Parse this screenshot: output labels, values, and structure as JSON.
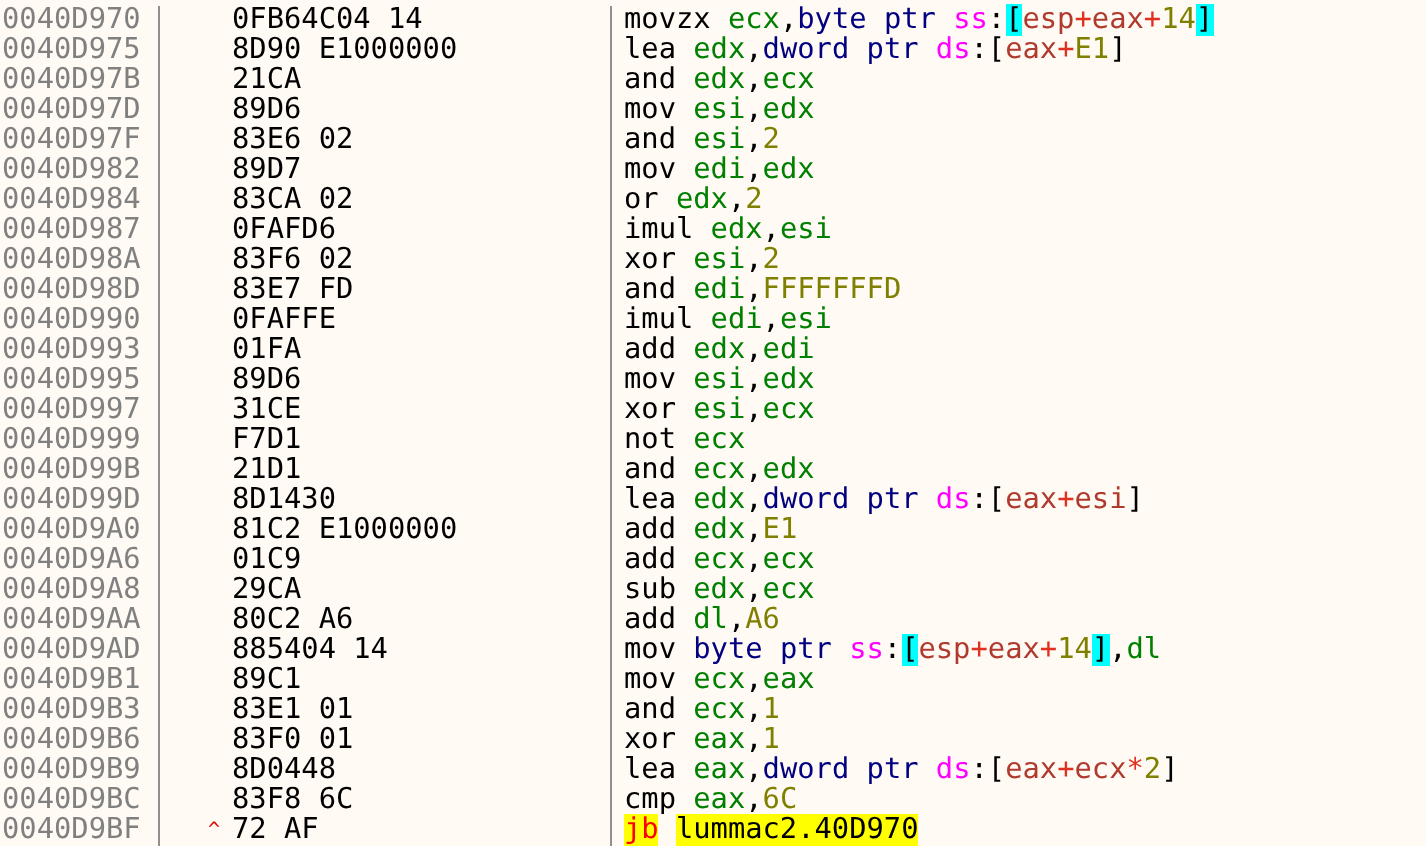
{
  "rows": [
    {
      "address": "0040D970",
      "bytes": "0FB64C04 14",
      "tokens": [
        {
          "text": "movzx",
          "kind": "mnemonic"
        },
        {
          "text": "ecx",
          "kind": "register"
        },
        {
          "text": ",",
          "kind": "punct"
        },
        {
          "text": "byte ptr",
          "kind": "size"
        },
        {
          "text": "ss",
          "kind": "segment"
        },
        {
          "text": ":",
          "kind": "punct"
        },
        {
          "text": "[",
          "kind": "stack_bracket"
        },
        {
          "text": "esp",
          "kind": "mem_register"
        },
        {
          "text": "+",
          "kind": "mem_operator"
        },
        {
          "text": "eax",
          "kind": "mem_register"
        },
        {
          "text": "+",
          "kind": "mem_operator"
        },
        {
          "text": "14",
          "kind": "mem_number"
        },
        {
          "text": "]",
          "kind": "stack_bracket"
        }
      ]
    },
    {
      "address": "0040D975",
      "bytes": "8D90 E1000000",
      "tokens": [
        {
          "text": "lea",
          "kind": "mnemonic"
        },
        {
          "text": "edx",
          "kind": "register"
        },
        {
          "text": ",",
          "kind": "punct"
        },
        {
          "text": "dword ptr",
          "kind": "size"
        },
        {
          "text": "ds",
          "kind": "segment"
        },
        {
          "text": ":",
          "kind": "punct"
        },
        {
          "text": "[",
          "kind": "bracket"
        },
        {
          "text": "eax",
          "kind": "mem_register"
        },
        {
          "text": "+",
          "kind": "mem_operator"
        },
        {
          "text": "E1",
          "kind": "mem_number"
        },
        {
          "text": "]",
          "kind": "bracket"
        }
      ]
    },
    {
      "address": "0040D97B",
      "bytes": "21CA",
      "tokens": [
        {
          "text": "and",
          "kind": "mnemonic"
        },
        {
          "text": "edx",
          "kind": "register"
        },
        {
          "text": ",",
          "kind": "punct"
        },
        {
          "text": "ecx",
          "kind": "register"
        }
      ]
    },
    {
      "address": "0040D97D",
      "bytes": "89D6",
      "tokens": [
        {
          "text": "mov",
          "kind": "mnemonic"
        },
        {
          "text": "esi",
          "kind": "register"
        },
        {
          "text": ",",
          "kind": "punct"
        },
        {
          "text": "edx",
          "kind": "register"
        }
      ]
    },
    {
      "address": "0040D97F",
      "bytes": "83E6 02",
      "tokens": [
        {
          "text": "and",
          "kind": "mnemonic"
        },
        {
          "text": "esi",
          "kind": "register"
        },
        {
          "text": ",",
          "kind": "punct"
        },
        {
          "text": "2",
          "kind": "number"
        }
      ]
    },
    {
      "address": "0040D982",
      "bytes": "89D7",
      "tokens": [
        {
          "text": "mov",
          "kind": "mnemonic"
        },
        {
          "text": "edi",
          "kind": "register"
        },
        {
          "text": ",",
          "kind": "punct"
        },
        {
          "text": "edx",
          "kind": "register"
        }
      ]
    },
    {
      "address": "0040D984",
      "bytes": "83CA 02",
      "tokens": [
        {
          "text": "or",
          "kind": "mnemonic"
        },
        {
          "text": "edx",
          "kind": "register"
        },
        {
          "text": ",",
          "kind": "punct"
        },
        {
          "text": "2",
          "kind": "number"
        }
      ]
    },
    {
      "address": "0040D987",
      "bytes": "0FAFD6",
      "tokens": [
        {
          "text": "imul",
          "kind": "mnemonic"
        },
        {
          "text": "edx",
          "kind": "register"
        },
        {
          "text": ",",
          "kind": "punct"
        },
        {
          "text": "esi",
          "kind": "register"
        }
      ]
    },
    {
      "address": "0040D98A",
      "bytes": "83F6 02",
      "tokens": [
        {
          "text": "xor",
          "kind": "mnemonic"
        },
        {
          "text": "esi",
          "kind": "register"
        },
        {
          "text": ",",
          "kind": "punct"
        },
        {
          "text": "2",
          "kind": "number"
        }
      ]
    },
    {
      "address": "0040D98D",
      "bytes": "83E7 FD",
      "tokens": [
        {
          "text": "and",
          "kind": "mnemonic"
        },
        {
          "text": "edi",
          "kind": "register"
        },
        {
          "text": ",",
          "kind": "punct"
        },
        {
          "text": "FFFFFFFD",
          "kind": "number"
        }
      ]
    },
    {
      "address": "0040D990",
      "bytes": "0FAFFE",
      "tokens": [
        {
          "text": "imul",
          "kind": "mnemonic"
        },
        {
          "text": "edi",
          "kind": "register"
        },
        {
          "text": ",",
          "kind": "punct"
        },
        {
          "text": "esi",
          "kind": "register"
        }
      ]
    },
    {
      "address": "0040D993",
      "bytes": "01FA",
      "tokens": [
        {
          "text": "add",
          "kind": "mnemonic"
        },
        {
          "text": "edx",
          "kind": "register"
        },
        {
          "text": ",",
          "kind": "punct"
        },
        {
          "text": "edi",
          "kind": "register"
        }
      ]
    },
    {
      "address": "0040D995",
      "bytes": "89D6",
      "tokens": [
        {
          "text": "mov",
          "kind": "mnemonic"
        },
        {
          "text": "esi",
          "kind": "register"
        },
        {
          "text": ",",
          "kind": "punct"
        },
        {
          "text": "edx",
          "kind": "register"
        }
      ]
    },
    {
      "address": "0040D997",
      "bytes": "31CE",
      "tokens": [
        {
          "text": "xor",
          "kind": "mnemonic"
        },
        {
          "text": "esi",
          "kind": "register"
        },
        {
          "text": ",",
          "kind": "punct"
        },
        {
          "text": "ecx",
          "kind": "register"
        }
      ]
    },
    {
      "address": "0040D999",
      "bytes": "F7D1",
      "tokens": [
        {
          "text": "not",
          "kind": "mnemonic"
        },
        {
          "text": "ecx",
          "kind": "register"
        }
      ]
    },
    {
      "address": "0040D99B",
      "bytes": "21D1",
      "tokens": [
        {
          "text": "and",
          "kind": "mnemonic"
        },
        {
          "text": "ecx",
          "kind": "register"
        },
        {
          "text": ",",
          "kind": "punct"
        },
        {
          "text": "edx",
          "kind": "register"
        }
      ]
    },
    {
      "address": "0040D99D",
      "bytes": "8D1430",
      "tokens": [
        {
          "text": "lea",
          "kind": "mnemonic"
        },
        {
          "text": "edx",
          "kind": "register"
        },
        {
          "text": ",",
          "kind": "punct"
        },
        {
          "text": "dword ptr",
          "kind": "size"
        },
        {
          "text": "ds",
          "kind": "segment"
        },
        {
          "text": ":",
          "kind": "punct"
        },
        {
          "text": "[",
          "kind": "bracket"
        },
        {
          "text": "eax",
          "kind": "mem_register"
        },
        {
          "text": "+",
          "kind": "mem_operator"
        },
        {
          "text": "esi",
          "kind": "mem_register"
        },
        {
          "text": "]",
          "kind": "bracket"
        }
      ]
    },
    {
      "address": "0040D9A0",
      "bytes": "81C2 E1000000",
      "tokens": [
        {
          "text": "add",
          "kind": "mnemonic"
        },
        {
          "text": "edx",
          "kind": "register"
        },
        {
          "text": ",",
          "kind": "punct"
        },
        {
          "text": "E1",
          "kind": "number"
        }
      ]
    },
    {
      "address": "0040D9A6",
      "bytes": "01C9",
      "tokens": [
        {
          "text": "add",
          "kind": "mnemonic"
        },
        {
          "text": "ecx",
          "kind": "register"
        },
        {
          "text": ",",
          "kind": "punct"
        },
        {
          "text": "ecx",
          "kind": "register"
        }
      ]
    },
    {
      "address": "0040D9A8",
      "bytes": "29CA",
      "tokens": [
        {
          "text": "sub",
          "kind": "mnemonic"
        },
        {
          "text": "edx",
          "kind": "register"
        },
        {
          "text": ",",
          "kind": "punct"
        },
        {
          "text": "ecx",
          "kind": "register"
        }
      ]
    },
    {
      "address": "0040D9AA",
      "bytes": "80C2 A6",
      "tokens": [
        {
          "text": "add",
          "kind": "mnemonic"
        },
        {
          "text": "dl",
          "kind": "register"
        },
        {
          "text": ",",
          "kind": "punct"
        },
        {
          "text": "A6",
          "kind": "number"
        }
      ]
    },
    {
      "address": "0040D9AD",
      "bytes": "885404 14",
      "tokens": [
        {
          "text": "mov",
          "kind": "mnemonic"
        },
        {
          "text": "byte ptr",
          "kind": "size"
        },
        {
          "text": "ss",
          "kind": "segment"
        },
        {
          "text": ":",
          "kind": "punct"
        },
        {
          "text": "[",
          "kind": "stack_bracket"
        },
        {
          "text": "esp",
          "kind": "mem_register"
        },
        {
          "text": "+",
          "kind": "mem_operator"
        },
        {
          "text": "eax",
          "kind": "mem_register"
        },
        {
          "text": "+",
          "kind": "mem_operator"
        },
        {
          "text": "14",
          "kind": "mem_number"
        },
        {
          "text": "]",
          "kind": "stack_bracket"
        },
        {
          "text": ",",
          "kind": "punct"
        },
        {
          "text": "dl",
          "kind": "register"
        }
      ]
    },
    {
      "address": "0040D9B1",
      "bytes": "89C1",
      "tokens": [
        {
          "text": "mov",
          "kind": "mnemonic"
        },
        {
          "text": "ecx",
          "kind": "register"
        },
        {
          "text": ",",
          "kind": "punct"
        },
        {
          "text": "eax",
          "kind": "register"
        }
      ]
    },
    {
      "address": "0040D9B3",
      "bytes": "83E1 01",
      "tokens": [
        {
          "text": "and",
          "kind": "mnemonic"
        },
        {
          "text": "ecx",
          "kind": "register"
        },
        {
          "text": ",",
          "kind": "punct"
        },
        {
          "text": "1",
          "kind": "number"
        }
      ]
    },
    {
      "address": "0040D9B6",
      "bytes": "83F0 01",
      "tokens": [
        {
          "text": "xor",
          "kind": "mnemonic"
        },
        {
          "text": "eax",
          "kind": "register"
        },
        {
          "text": ",",
          "kind": "punct"
        },
        {
          "text": "1",
          "kind": "number"
        }
      ]
    },
    {
      "address": "0040D9B9",
      "bytes": "8D0448",
      "tokens": [
        {
          "text": "lea",
          "kind": "mnemonic"
        },
        {
          "text": "eax",
          "kind": "register"
        },
        {
          "text": ",",
          "kind": "punct"
        },
        {
          "text": "dword ptr",
          "kind": "size"
        },
        {
          "text": "ds",
          "kind": "segment"
        },
        {
          "text": ":",
          "kind": "punct"
        },
        {
          "text": "[",
          "kind": "bracket"
        },
        {
          "text": "eax",
          "kind": "mem_register"
        },
        {
          "text": "+",
          "kind": "mem_operator"
        },
        {
          "text": "ecx",
          "kind": "mem_register"
        },
        {
          "text": "*",
          "kind": "mem_operator"
        },
        {
          "text": "2",
          "kind": "mem_number"
        },
        {
          "text": "]",
          "kind": "bracket"
        }
      ]
    },
    {
      "address": "0040D9BC",
      "bytes": "83F8 6C",
      "tokens": [
        {
          "text": "cmp",
          "kind": "mnemonic"
        },
        {
          "text": "eax",
          "kind": "register"
        },
        {
          "text": ",",
          "kind": "punct"
        },
        {
          "text": "6C",
          "kind": "number"
        }
      ]
    },
    {
      "address": "0040D9BF",
      "arrow": "^",
      "bytes": "72 AF",
      "tokens": [
        {
          "text": "jb",
          "kind": "jump_mnemonic"
        },
        {
          "text": "lummac2.40D970",
          "kind": "jump_label"
        }
      ]
    }
  ]
}
